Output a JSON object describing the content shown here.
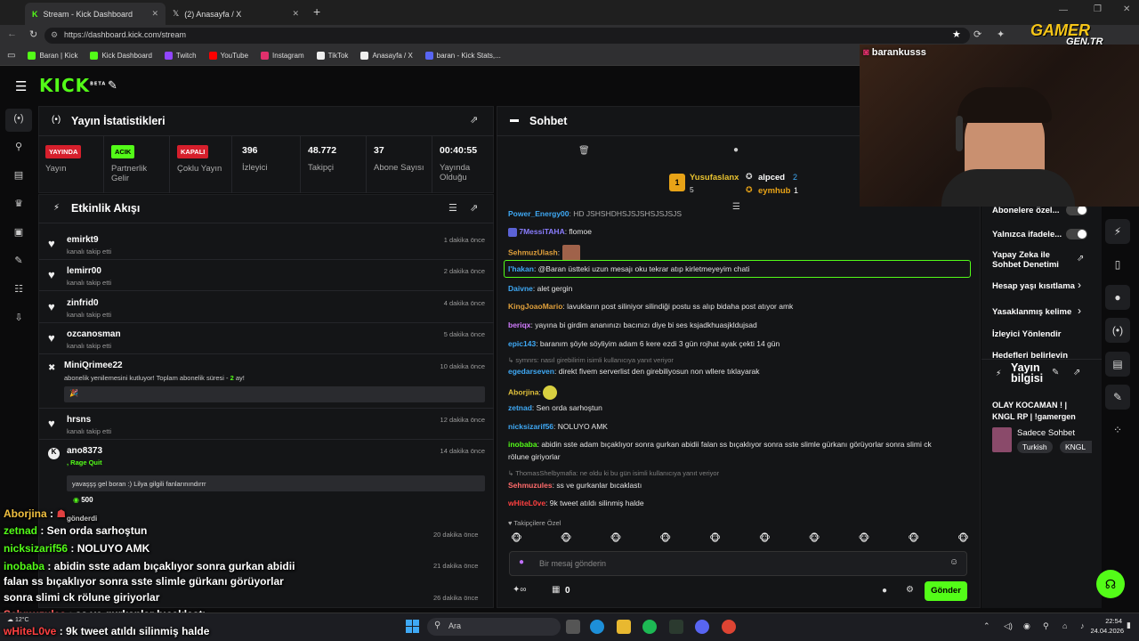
{
  "browser": {
    "tabs": [
      {
        "title": "Stream - Kick Dashboard",
        "active": true
      },
      {
        "title": "(2) Anasayfa / X",
        "active": false
      }
    ],
    "url": "https://dashboard.kick.com/stream",
    "bookmarks": [
      {
        "label": "Baran | Kick",
        "color": "#53fc18"
      },
      {
        "label": "Kick Dashboard",
        "color": "#53fc18"
      },
      {
        "label": "Twitch",
        "color": "#9146ff"
      },
      {
        "label": "YouTube",
        "color": "#ff0000"
      },
      {
        "label": "Instagram",
        "color": "#e1306c"
      },
      {
        "label": "TikTok",
        "color": "#ffffff"
      },
      {
        "label": "Anasayfa / X",
        "color": "#ffffff"
      },
      {
        "label": "baran - Kick Stats,...",
        "color": "#5865f2"
      }
    ]
  },
  "app": {
    "logo": "KICK",
    "logo_sup": "BETA"
  },
  "stats": {
    "title": "Yayın İstatistikleri",
    "cells": [
      {
        "badge": "YAYINDA",
        "badge_color": "#d61f2c",
        "label": "Yayın"
      },
      {
        "badge": "ACIK",
        "badge_color": "#53fc18",
        "label": "Partnerlik Gelir"
      },
      {
        "badge": "KAPALI",
        "badge_color": "#d61f2c",
        "label": "Çoklu Yayın"
      },
      {
        "value": "396",
        "label": "İzleyici"
      },
      {
        "value": "48.772",
        "label": "Takipçi"
      },
      {
        "value": "37",
        "label": "Abone Sayısı"
      },
      {
        "value": "00:40:55",
        "label": "Yayında Olduğu"
      }
    ]
  },
  "activity": {
    "title": "Etkinlik Akışı",
    "events": [
      {
        "name": "emirkt9",
        "sub": "kanalı takip etti",
        "time": "1 dakika önce"
      },
      {
        "name": "lemirr00",
        "sub": "kanalı takip etti",
        "time": "2 dakika önce"
      },
      {
        "name": "zinfrid0",
        "sub": "kanalı takip etti",
        "time": "4 dakika önce"
      },
      {
        "name": "ozcanosman",
        "sub": "kanalı takip etti",
        "time": "5 dakika önce"
      }
    ],
    "sub_event": {
      "name": "MiniQrimee22",
      "sub": "abonelik yenilemesini kutluyor! Toplam abonelik süresi - ",
      "months": "2",
      "months_suffix": " ay!",
      "time": "10 dakika önce"
    },
    "follow2": {
      "name": "hrsns",
      "sub": "kanalı takip etti",
      "time": "12 dakika önce"
    },
    "tip_event": {
      "name": "ano8373",
      "sub": ", Rage Quit",
      "message": "yavaşşş gel boran :) Lilya gilgili fanlarınındırrr",
      "amount": "500",
      "time": "14 dakika önce"
    },
    "more_times": [
      "20 dakika önce",
      "21 dakika önce",
      "26 dakika önce"
    ]
  },
  "chat": {
    "title": "Sohbet",
    "top_chatters": [
      {
        "name": "Yusufaslanx",
        "count": "5"
      },
      {
        "name": "alpced",
        "count": "2"
      },
      {
        "name": "eymhub",
        "count": "1"
      }
    ],
    "messages": [
      {
        "user": "Power_Energy00",
        "text": ": HD JSHSHDHSJSJSHSJSJSJS",
        "color": "#3fa9f5"
      },
      {
        "user": "7MessiTAHA",
        "text": ": flomoe",
        "color": "#8a7dff"
      },
      {
        "user": "SehmuzUlash",
        "text": ":",
        "color": "#e0a03b"
      },
      {
        "user": "l'hakan",
        "text": ": @Baran üstteki uzun mesajı oku tekrar atıp kirletmeyeyim chati",
        "color": "#3fa9f5"
      },
      {
        "user": "Daivne",
        "text": ": alet gergin",
        "color": "#3fa9f5"
      },
      {
        "user": "KingJoaoMario",
        "text": ": lavukların post siliniyor silindiği postu ss alıp bidaha post atıyor amk",
        "color": "#e0a03b"
      },
      {
        "user": "beriqx",
        "text": ": yayına bi girdim ananınızı bacınızı diye bi ses ksjadkhuasjkldujsad",
        "color": "#d27cff"
      },
      {
        "user": "epic143",
        "text": ": baranım şöyle söyliyim adam 6 kere ezdi 3 gün rojhat ayak çekti 14 gün",
        "color": "#3fa9f5"
      },
      {
        "user": "egedarseven",
        "text": ": direkt fivem serverlist den girebiliyosun non wllere tıklayarak",
        "color": "#3fa9f5"
      },
      {
        "user": "Aborjina",
        "text": ":",
        "color": "#e0c03b"
      },
      {
        "user": "zetnad",
        "text": ": Sen orda sarhoştun",
        "color": "#3fa9f5"
      },
      {
        "user": "nicksizarif56",
        "text": ": NOLUYO AMK",
        "color": "#3fa9f5"
      },
      {
        "user": "inobaba",
        "text": ": abidin sste adam bıçaklıyor sonra gurkan abidii falan ss bıçaklıyor sonra sste slimle gürkanı görüyorlar sonra slimi ck",
        "text2": "rölune giriyorlar",
        "color": "#53fc18"
      },
      {
        "user": "Sehmuzules",
        "text": ": ss ve gurkanlar bıcaklastı",
        "color": "#ff6b6b"
      },
      {
        "user": "wHiteL0ve",
        "text": ": 9k tweet atıldı silinmiş halde",
        "color": "#ff4040"
      }
    ],
    "reply1": "symnrs: nasıl girebilirim isimli kullanıcıya yanıt veriyor",
    "reply2": "ThomasShelbymafia: ne oldu ki bu gün isimli kullanıcıya yanıt veriyor",
    "followers_only": "Takipçilere Özel",
    "input_placeholder": "Bir mesaj gönderin",
    "send_label": "Gönder",
    "points": "0"
  },
  "settings": {
    "items": [
      {
        "label": "Abonelere özel..."
      },
      {
        "label": "Yalnızca ifadele..."
      },
      {
        "label": "Yapay Zeka ile Sohbet Denetimi"
      },
      {
        "label": "Hesap yaşı kısıtlama"
      },
      {
        "label": "Yasaklanmış kelime"
      },
      {
        "label": "İzleyici Yönlendir"
      },
      {
        "label": "Hedefleri belirleyin"
      }
    ]
  },
  "stream_info": {
    "title": "Yayın bilgisi",
    "stream_title": "OLAY KOCAMAN ! | KNGL RP | !gamergen",
    "category": "Sadece Sohbet",
    "tags": [
      "Turkish",
      "KNGL"
    ]
  },
  "webcam": {
    "name": "barankusss"
  },
  "watermark": {
    "line1": "GAMER",
    "line2": "GEN.TR"
  },
  "overlay_chat": [
    {
      "user": "Aborjina",
      "text": " :",
      "color": "#f0c040"
    },
    {
      "user": "zetnad",
      "text": " : Sen orda sarhoştun",
      "color": "#53fc18"
    },
    {
      "user": "nicksizarif56",
      "text": " : NOLUYO AMK",
      "color": "#53fc18"
    },
    {
      "user": "inobaba",
      "text": " : abidin sste adam bıçaklıyor sonra gurkan abidii",
      "color": "#53fc18"
    },
    {
      "user": "",
      "text": "falan ss bıçaklıyor sonra sste slimle gürkanı görüyorlar",
      "color": "#fff"
    },
    {
      "user": "",
      "text": "sonra slimi ck rölune giriyorlar",
      "color": "#fff"
    },
    {
      "user": "Sehmuzules",
      "text": " : ss ve gurkanlar bıcaklastı",
      "color": "#ff6060"
    },
    {
      "user": "wHiteL0ve",
      "text": " : 9k tweet atıldı silinmiş halde",
      "color": "#ff4040"
    }
  ],
  "overlay_extra": {
    "gonderdi": "gönderdi",
    "ws_tag": "whitetolueer"
  },
  "taskbar": {
    "search": "Ara",
    "temp": "12°C",
    "time": "22:54",
    "date": "24.04.2026"
  }
}
